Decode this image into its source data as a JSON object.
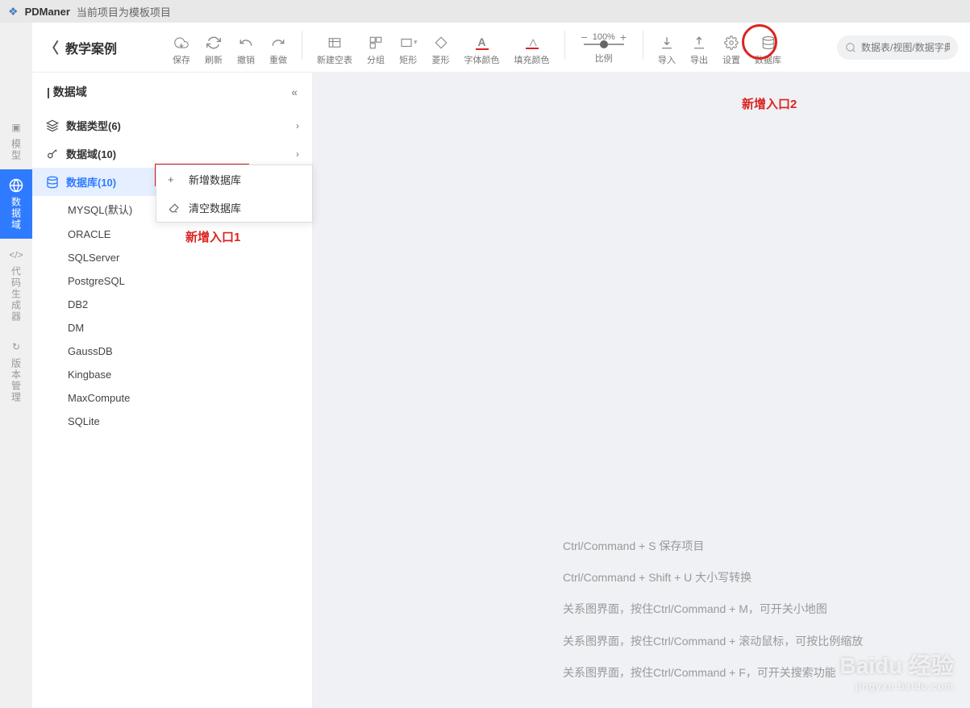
{
  "titlebar": {
    "appname": "PDManer",
    "subtitle": "当前项目为模板项目"
  },
  "header": {
    "back_label": "教学案例"
  },
  "toolbar": {
    "save": "保存",
    "refresh": "刷新",
    "undo": "撤销",
    "redo": "重做",
    "newtable": "新建空表",
    "group": "分组",
    "rect": "矩形",
    "rhombus": "菱形",
    "fontcolor": "字体颜色",
    "fillcolor": "填充颜色",
    "zoom_pct": "100%",
    "zoom_label": "比例",
    "import": "导入",
    "export": "导出",
    "settings": "设置",
    "database": "数据库"
  },
  "search": {
    "placeholder": "数据表/视图/数据字典"
  },
  "vnav": {
    "items": [
      {
        "label": "模型"
      },
      {
        "label": "数据域"
      },
      {
        "label": "代码生成器"
      },
      {
        "label": "版本管理"
      }
    ]
  },
  "sidebar": {
    "header": "| 数据域",
    "cat1": "数据类型(6)",
    "cat2": "数据域(10)",
    "cat3": "数据库(10)",
    "dbs": [
      "MYSQL(默认)",
      "ORACLE",
      "SQLServer",
      "PostgreSQL",
      "DB2",
      "DM",
      "GaussDB",
      "Kingbase",
      "MaxCompute",
      "SQLite"
    ]
  },
  "context_menu": {
    "add": "新增数据库",
    "clear": "清空数据库"
  },
  "annotations": {
    "entry1": "新增入口1",
    "entry2": "新增入口2"
  },
  "hints": [
    "Ctrl/Command + S 保存项目",
    "Ctrl/Command + Shift + U 大小写转换",
    "关系图界面，按住Ctrl/Command + M，可开关小地图",
    "关系图界面，按住Ctrl/Command + 滚动鼠标，可按比例缩放",
    "关系图界面，按住Ctrl/Command + F，可开关搜索功能"
  ],
  "watermark": {
    "main": "Baidu 经验",
    "sub": "jingyan.baidu.com"
  }
}
